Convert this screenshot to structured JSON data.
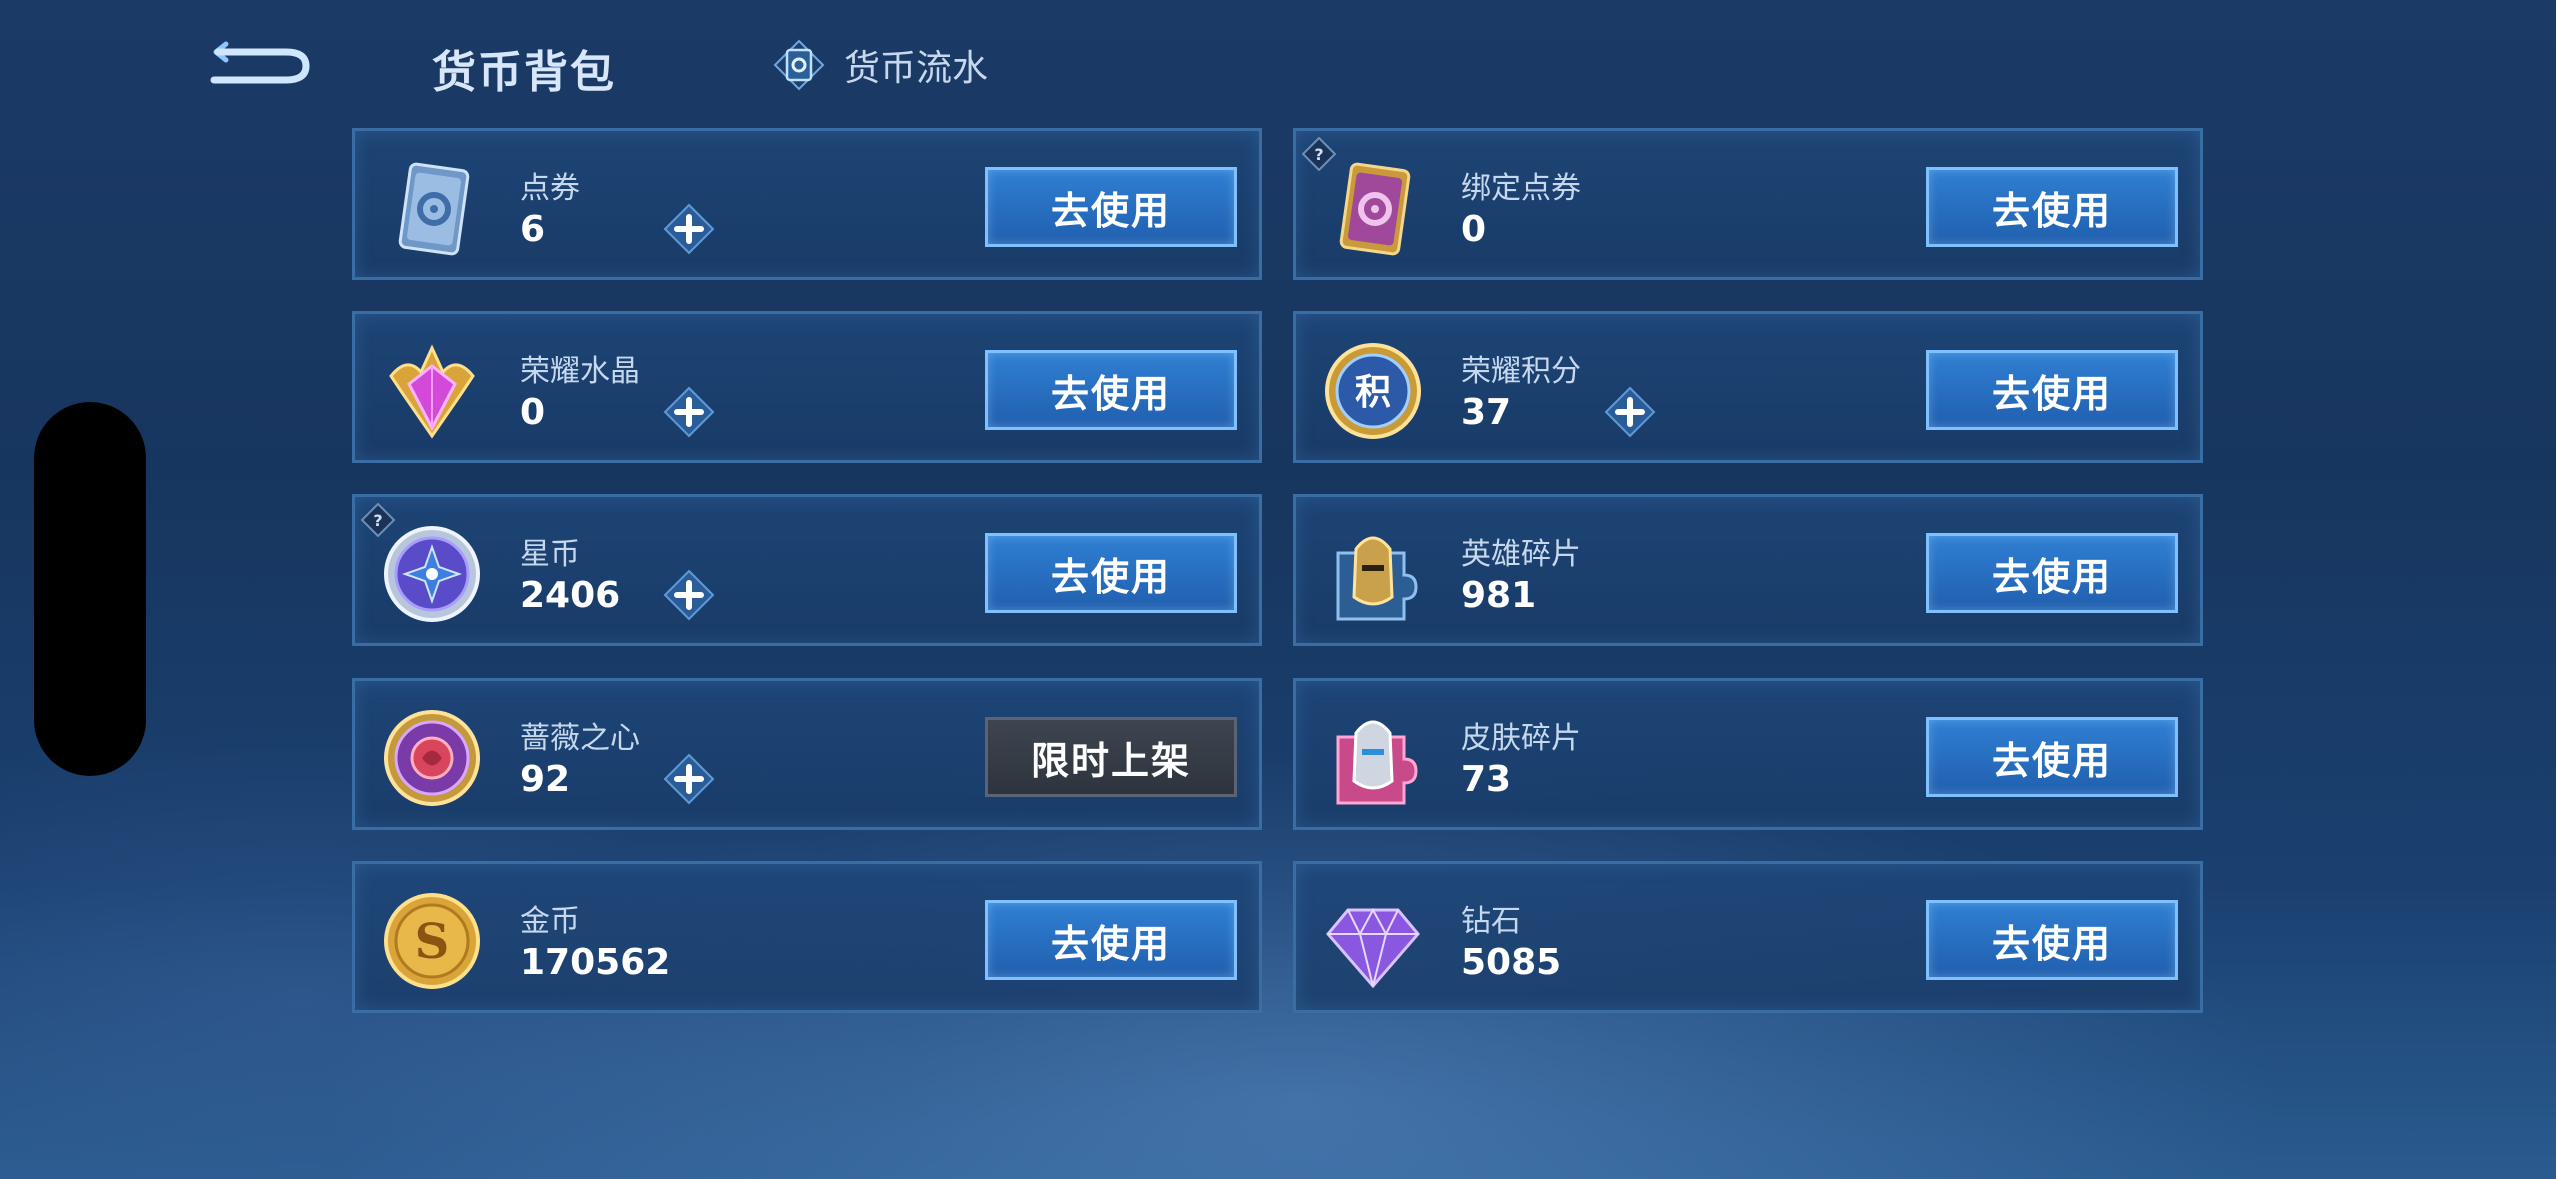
{
  "header": {
    "title": "货币背包",
    "flow_label": "货币流水"
  },
  "colors": {
    "background": "#17365f",
    "card_border": "#3a6da4",
    "button": "#2f7fd3",
    "button_disabled": "#3d4550"
  },
  "cards": [
    {
      "label": "点券",
      "value": "6",
      "button": "去使用",
      "icon": "ticket-icon",
      "has_plus": true,
      "has_help": false
    },
    {
      "label": "绑定点券",
      "value": "0",
      "button": "去使用",
      "icon": "bound-ticket-icon",
      "has_plus": false,
      "has_help": true
    },
    {
      "label": "荣耀水晶",
      "value": "0",
      "button": "去使用",
      "icon": "glory-crystal-icon",
      "has_plus": true,
      "has_help": false
    },
    {
      "label": "荣耀积分",
      "value": "37",
      "button": "去使用",
      "icon": "glory-points-icon",
      "has_plus": true,
      "has_help": false
    },
    {
      "label": "星币",
      "value": "2406",
      "button": "去使用",
      "icon": "star-coin-icon",
      "has_plus": true,
      "has_help": true
    },
    {
      "label": "英雄碎片",
      "value": "981",
      "button": "去使用",
      "icon": "hero-fragment-icon",
      "has_plus": false,
      "has_help": false
    },
    {
      "label": "蔷薇之心",
      "value": "92",
      "button": "限时上架",
      "icon": "rose-heart-icon",
      "has_plus": true,
      "has_help": false
    },
    {
      "label": "皮肤碎片",
      "value": "73",
      "button": "去使用",
      "icon": "skin-fragment-icon",
      "has_plus": false,
      "has_help": false
    },
    {
      "label": "金币",
      "value": "170562",
      "button": "去使用",
      "icon": "gold-coin-icon",
      "has_plus": false,
      "has_help": false
    },
    {
      "label": "钻石",
      "value": "5085",
      "button": "去使用",
      "icon": "diamond-icon",
      "has_plus": false,
      "has_help": false
    }
  ]
}
